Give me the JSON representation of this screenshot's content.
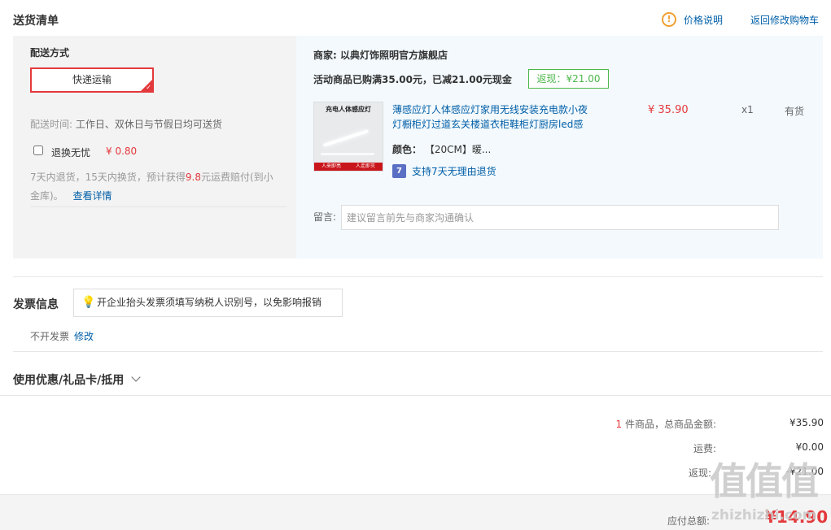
{
  "header": {
    "title": "送货清单",
    "price_note_label": "价格说明",
    "back_to_cart_label": "返回修改购物车"
  },
  "delivery": {
    "section_label": "配送方式",
    "method_label": "快递运输",
    "time_label": "配送时间:",
    "time_value": "工作日、双休日与节假日均可送货",
    "return_insurance_label": "退换无忧",
    "return_insurance_price": "¥ 0.80",
    "return_desc_prefix": "7天内退货，15天内换货，预计获得",
    "return_desc_amount": "9.8",
    "return_desc_suffix": "元运费赔付(到小",
    "return_desc_line2": "金库)。",
    "details_link": "查看详情"
  },
  "order": {
    "merchant_label": "商家:",
    "merchant_name": "以典灯饰照明官方旗舰店",
    "promo_text": "活动商品已购满35.00元，已减21.00元现金",
    "rebate_label": "返现：¥21.00",
    "product": {
      "image_caption": "充电人体感应灯",
      "image_banner_left": "人来即亮",
      "image_banner_right": "人走即灭",
      "name_line1": "薄感应灯人体感应灯家用无线安装充电款小夜",
      "name_line2": "灯橱柜灯过道玄关楼道衣柜鞋柜灯厨房led感",
      "color_label": "颜色：",
      "color_value": "【20CM】暖...",
      "return_badge": "7",
      "return_policy": "支持7天无理由退货",
      "price": "¥ 35.90",
      "quantity": "x1",
      "stock": "有货"
    },
    "memo_label": "留言:",
    "memo_placeholder": "建议留言前先与商家沟通确认"
  },
  "invoice": {
    "title": "发票信息",
    "tip": "开企业抬头发票须填写纳税人识别号，以免影响报销",
    "status": "不开发票",
    "edit_label": "修改"
  },
  "coupon": {
    "title": "使用优惠/礼品卡/抵用"
  },
  "summary": {
    "item_count": "1",
    "items_label": "件商品，总商品金额:",
    "items_total": "¥35.90",
    "shipping_label": "运费:",
    "shipping_value": "¥0.00",
    "rebate_label": "返现:",
    "rebate_value": "-¥21.00",
    "payable_label": "应付总额:",
    "payable_value": "¥14.90"
  },
  "watermark": {
    "logo": "值值值",
    "site": "zhizhizhi.com"
  },
  "colors": {
    "accent_red": "#e4393c",
    "link_blue": "#005ea7",
    "rebate_green": "#4cb84a",
    "tip_orange": "#f0a032"
  }
}
